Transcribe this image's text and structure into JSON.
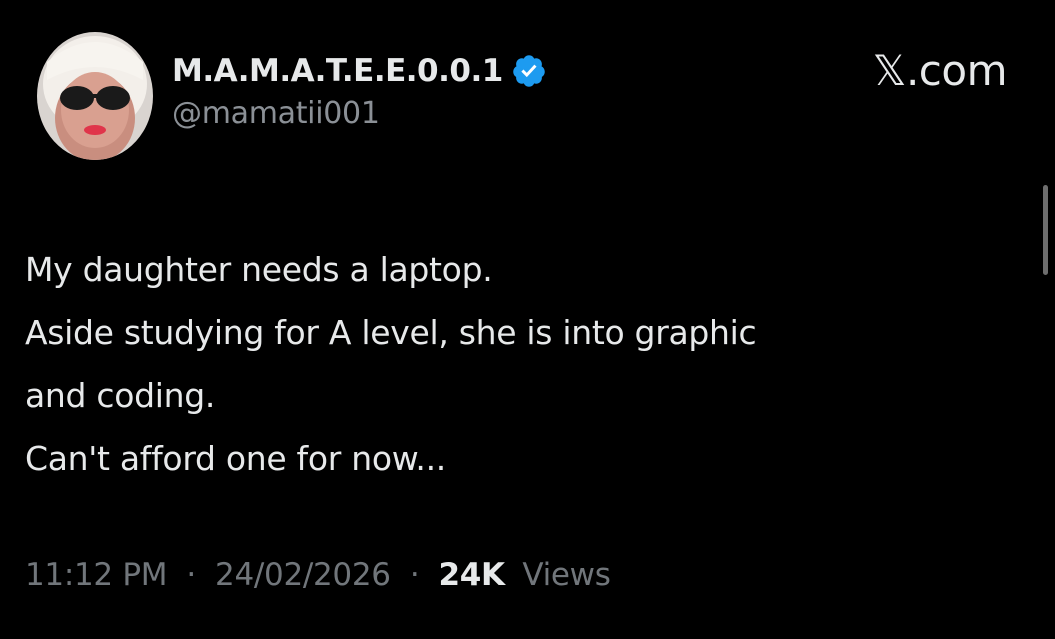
{
  "author": {
    "display_name": "M.A.M.A.T.E.E.0.0.1",
    "handle": "@mamatii001",
    "verified": true,
    "avatar_icon": "profile-photo"
  },
  "source_label": "𝕏.com",
  "tweet": {
    "lines": [
      "My daughter needs a laptop.",
      "Aside studying for A level, she is into graphic",
      "and coding.",
      "Can't afford one for now..."
    ]
  },
  "meta": {
    "time": "11:12 PM",
    "separator": "·",
    "date": "24/02/2026",
    "views_count": "24K",
    "views_label": "Views"
  },
  "colors": {
    "background": "#000000",
    "primary_text": "#e7e9ea",
    "secondary_text": "#71767b",
    "verified_badge": "#1d9bf0"
  }
}
